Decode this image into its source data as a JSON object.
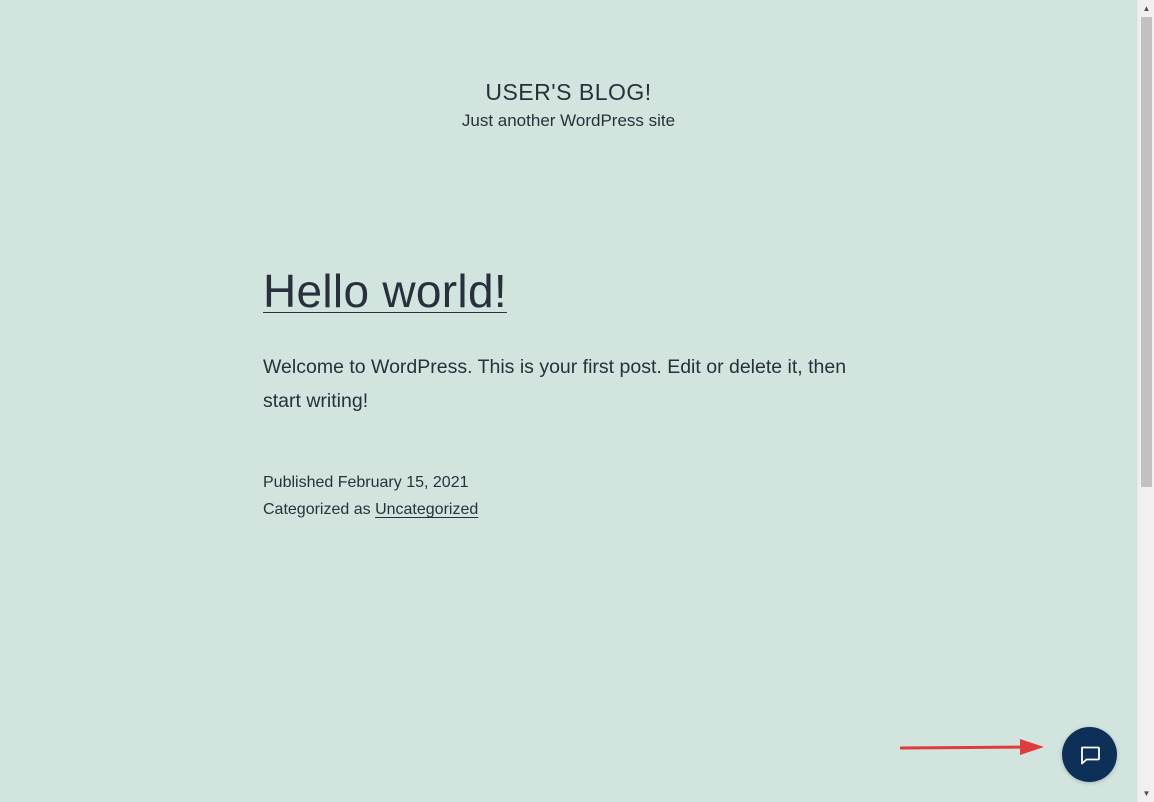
{
  "site": {
    "title": "USER'S BLOG!",
    "description": "Just another WordPress site"
  },
  "post": {
    "title": "Hello world!",
    "body": "Welcome to WordPress. This is your first post. Edit or delete it, then start writing!",
    "published_label": "Published",
    "published_date": "February 15, 2021",
    "category_label": "Categorized as",
    "category": "Uncategorized"
  },
  "widgets": {
    "chat_icon": "chat-bubble-icon",
    "annotation_arrow_color": "#e03c3c"
  },
  "colors": {
    "background": "#d1e4dd",
    "text": "#28303d",
    "chat_button": "#0d3058"
  }
}
